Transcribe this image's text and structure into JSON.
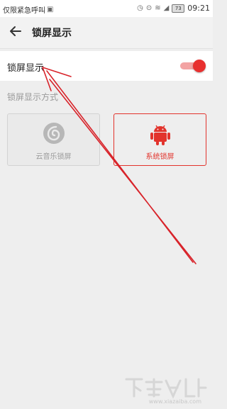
{
  "status_bar": {
    "left_text": "仅限紧急呼叫",
    "battery": "73",
    "time": "09:21"
  },
  "header": {
    "title": "锁屏显示"
  },
  "setting_row": {
    "label": "锁屏显示",
    "toggle_on": true
  },
  "section": {
    "label": "锁屏显示方式"
  },
  "options": [
    {
      "label": "云音乐锁屏",
      "icon": "netease-music-icon",
      "selected": false
    },
    {
      "label": "系统锁屏",
      "icon": "android-icon",
      "selected": true
    }
  ],
  "colors": {
    "accent": "#e8302f",
    "arrow": "#d8232a"
  },
  "watermark": {
    "text": "www.xiazaiba.com"
  }
}
